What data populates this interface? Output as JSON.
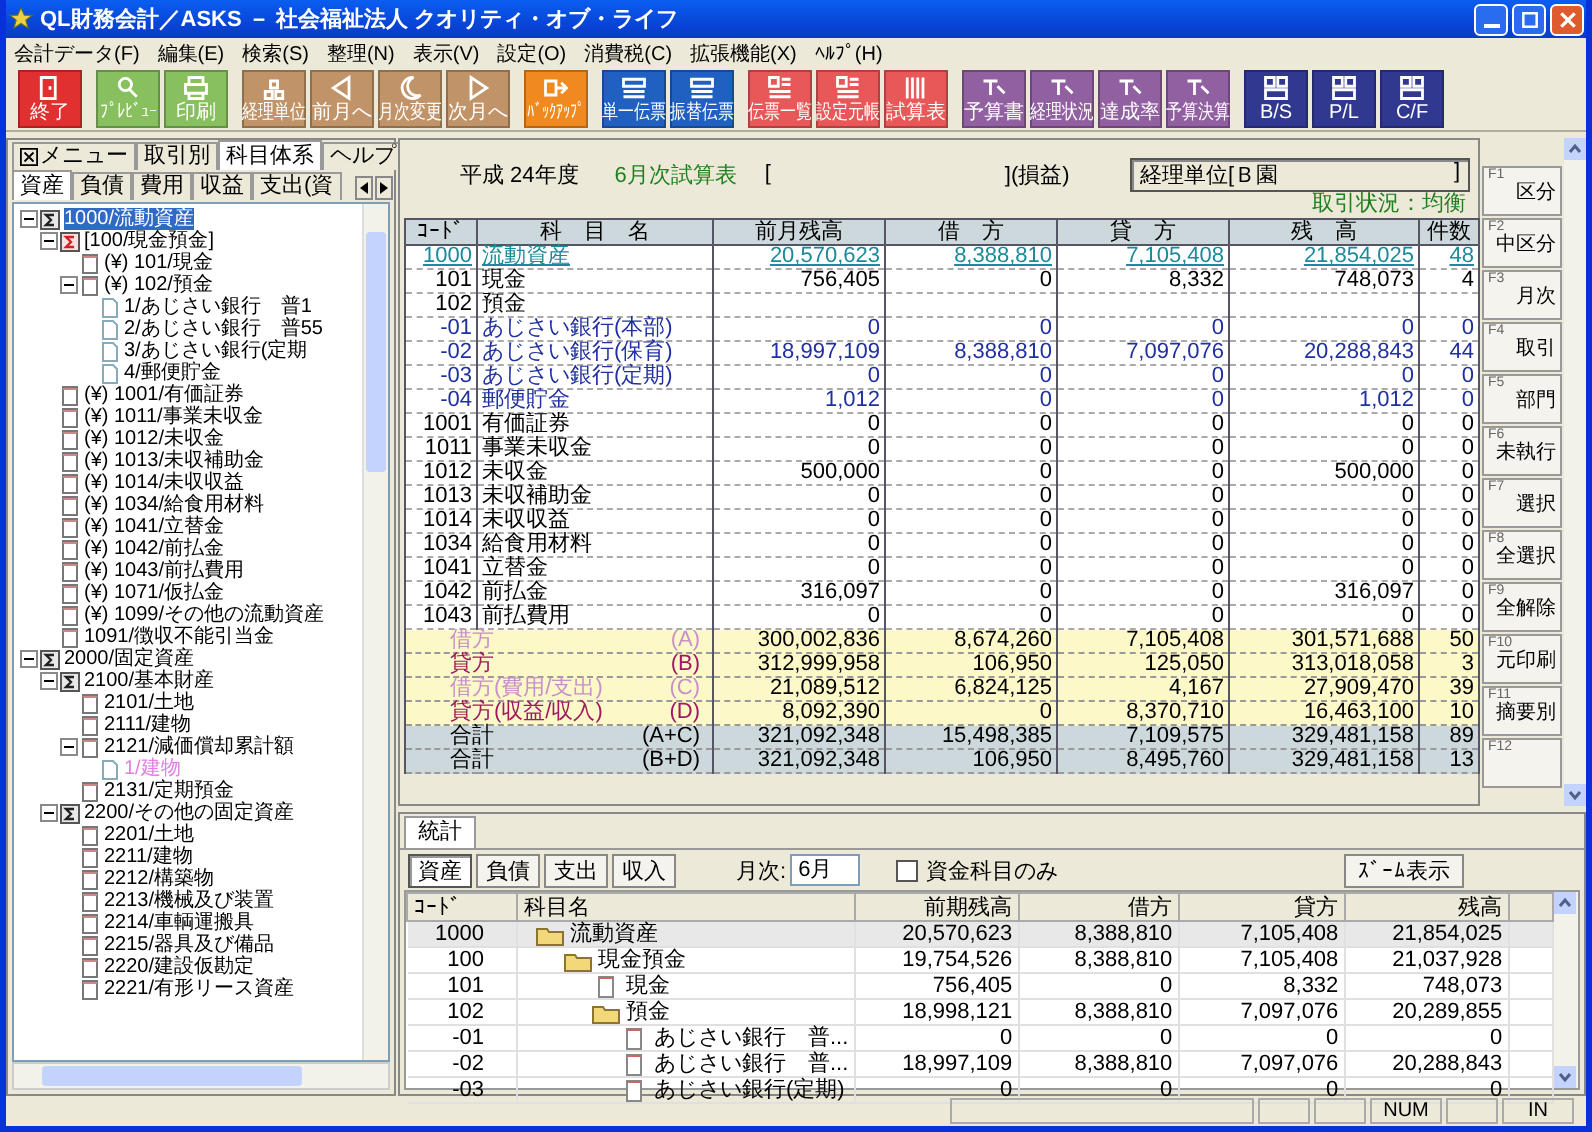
{
  "window": {
    "title": "QL財務会計／ASKS － 社会福祉法人 クオリティ・オブ・ライフ"
  },
  "menu": [
    "会計データ(F)",
    "編集(E)",
    "検索(S)",
    "整理(N)",
    "表示(V)",
    "設定(O)",
    "消費税(C)",
    "拡張機能(X)",
    "ﾍﾙﾌﾟ(H)"
  ],
  "toolbar": [
    {
      "label": "終了",
      "color": "#e03030"
    },
    {
      "label": "ﾌﾟﾚﾋﾞｭｰ",
      "color": "#88c060"
    },
    {
      "label": "印刷",
      "color": "#88c060"
    },
    {
      "label": "経理単位",
      "color": "#c09468"
    },
    {
      "label": "前月へ",
      "color": "#c09468"
    },
    {
      "label": "月次変更",
      "color": "#c09468"
    },
    {
      "label": "次月へ",
      "color": "#c09468"
    },
    {
      "label": "ﾊﾞｯｸｱｯﾌﾟ",
      "color": "#f08a20"
    },
    {
      "label": "単一伝票",
      "color": "#2060c0"
    },
    {
      "label": "振替伝票",
      "color": "#2060c0"
    },
    {
      "label": "伝票一覧",
      "color": "#e85858"
    },
    {
      "label": "設定元帳",
      "color": "#e85858"
    },
    {
      "label": "試算表",
      "color": "#e85858"
    },
    {
      "label": "予算書",
      "color": "#9060a0"
    },
    {
      "label": "経理状況",
      "color": "#9060a0"
    },
    {
      "label": "達成率",
      "color": "#9060a0"
    },
    {
      "label": "予算決算",
      "color": "#9060a0"
    },
    {
      "label": "B/S",
      "color": "#303890"
    },
    {
      "label": "P/L",
      "color": "#303890"
    },
    {
      "label": "C/F",
      "color": "#303890"
    }
  ],
  "left_panel": {
    "tabs": [
      {
        "label": "メニュー",
        "selected": false
      },
      {
        "label": "取引別",
        "selected": false
      },
      {
        "label": "科目体系",
        "selected": true
      },
      {
        "label": "ヘルプ",
        "selected": false
      }
    ],
    "subtabs": [
      {
        "label": "資産",
        "selected": true
      },
      {
        "label": "負債",
        "selected": false
      },
      {
        "label": "費用",
        "selected": false
      },
      {
        "label": "収益",
        "selected": false
      },
      {
        "label": "支出(資",
        "selected": false
      }
    ],
    "tree": [
      {
        "label": "1000/流動資産",
        "kind": "sum",
        "selected": true,
        "expanded": true,
        "children": [
          {
            "label": "[100/現金預金]",
            "kind": "sum-red",
            "selected": false,
            "expanded": true,
            "children": [
              {
                "label": "(¥) 101/現金",
                "kind": "account",
                "selected": false
              },
              {
                "label": "(¥) 102/預金",
                "kind": "account",
                "selected": false,
                "expanded": true,
                "children": [
                  {
                    "label": "1/あじさい銀行　普1",
                    "kind": "sub",
                    "selected": false
                  },
                  {
                    "label": "2/あじさい銀行　普55",
                    "kind": "sub",
                    "selected": false
                  },
                  {
                    "label": "3/あじさい銀行(定期",
                    "kind": "sub",
                    "selected": false
                  },
                  {
                    "label": "4/郵便貯金",
                    "kind": "sub",
                    "selected": false
                  }
                ]
              }
            ]
          },
          {
            "label": "(¥) 1001/有価証券",
            "kind": "account",
            "selected": false
          },
          {
            "label": "(¥) 1011/事業未収金",
            "kind": "account",
            "selected": false
          },
          {
            "label": "(¥) 1012/未収金",
            "kind": "account",
            "selected": false
          },
          {
            "label": "(¥) 1013/未収補助金",
            "kind": "account",
            "selected": false
          },
          {
            "label": "(¥) 1014/未収収益",
            "kind": "account",
            "selected": false
          },
          {
            "label": "(¥) 1034/給食用材料",
            "kind": "account",
            "selected": false
          },
          {
            "label": "(¥) 1041/立替金",
            "kind": "account",
            "selected": false
          },
          {
            "label": "(¥) 1042/前払金",
            "kind": "account",
            "selected": false
          },
          {
            "label": "(¥) 1043/前払費用",
            "kind": "account",
            "selected": false
          },
          {
            "label": "(¥) 1071/仮払金",
            "kind": "account",
            "selected": false
          },
          {
            "label": "(¥) 1099/その他の流動資産",
            "kind": "account",
            "selected": false
          },
          {
            "label": "1091/徴収不能引当金",
            "kind": "account",
            "selected": false
          }
        ]
      },
      {
        "label": "2000/固定資産",
        "kind": "sum",
        "selected": false,
        "expanded": true,
        "children": [
          {
            "label": "2100/基本財産",
            "kind": "sum",
            "selected": false,
            "expanded": true,
            "children": [
              {
                "label": "2101/土地",
                "kind": "account",
                "selected": false
              },
              {
                "label": "2111/建物",
                "kind": "account",
                "selected": false
              },
              {
                "label": "2121/減価償却累計額",
                "kind": "account",
                "selected": false,
                "expanded": true,
                "children": [
                  {
                    "label": "1/建物",
                    "kind": "sub-off",
                    "selected": false
                  }
                ]
              },
              {
                "label": "2131/定期預金",
                "kind": "account",
                "selected": false
              }
            ]
          },
          {
            "label": "2200/その他の固定資産",
            "kind": "sum",
            "selected": false,
            "expanded": true,
            "children": [
              {
                "label": "2201/土地",
                "kind": "account",
                "selected": false
              },
              {
                "label": "2211/建物",
                "kind": "account",
                "selected": false
              },
              {
                "label": "2212/構築物",
                "kind": "account",
                "selected": false
              },
              {
                "label": "2213/機械及び装置",
                "kind": "account",
                "selected": false
              },
              {
                "label": "2214/車輌運搬具",
                "kind": "account",
                "selected": false
              },
              {
                "label": "2215/器具及び備品",
                "kind": "account",
                "selected": false
              },
              {
                "label": "2220/建設仮勘定",
                "kind": "account",
                "selected": false
              },
              {
                "label": "2221/有形リース資産",
                "kind": "account",
                "selected": false
              }
            ]
          }
        ]
      }
    ]
  },
  "report": {
    "fiscal_year": "平成 24年度",
    "title": "6月次試算表",
    "bracket_open": "[",
    "bracket_close": "](損益)",
    "unit": "経理単位[Ｂ園",
    "unit_close": "]",
    "status": "取引状況：均衡",
    "columns": [
      "ｺｰﾄﾞ",
      "科　目　名",
      "前月残高",
      "借　方",
      "貸　方",
      "残　高",
      "件数"
    ],
    "rows": [
      {
        "kind": "group",
        "code": "1000",
        "name": "流動資産",
        "values": [
          "20,570,623",
          "8,388,810",
          "7,105,408",
          "21,854,025",
          "48"
        ]
      },
      {
        "kind": "account",
        "code": "101",
        "name": "現金",
        "values": [
          "756,405",
          "0",
          "8,332",
          "748,073",
          "4"
        ]
      },
      {
        "kind": "account",
        "code": "102",
        "name": "預金"
      },
      {
        "kind": "sub",
        "code": "-01",
        "name": "あじさい銀行(本部)",
        "values": [
          "0",
          "0",
          "0",
          "0",
          "0"
        ]
      },
      {
        "kind": "sub",
        "code": "-02",
        "name": "あじさい銀行(保育)",
        "values": [
          "18,997,109",
          "8,388,810",
          "7,097,076",
          "20,288,843",
          "44"
        ]
      },
      {
        "kind": "sub",
        "code": "-03",
        "name": "あじさい銀行(定期)",
        "values": [
          "0",
          "0",
          "0",
          "0",
          "0"
        ]
      },
      {
        "kind": "sub",
        "code": "-04",
        "name": "郵便貯金",
        "values": [
          "1,012",
          "0",
          "0",
          "1,012",
          "0"
        ]
      },
      {
        "kind": "account",
        "code": "1001",
        "name": "有価証券",
        "values": [
          "0",
          "0",
          "0",
          "0",
          "0"
        ]
      },
      {
        "kind": "account",
        "code": "1011",
        "name": "事業未収金",
        "values": [
          "0",
          "0",
          "0",
          "0",
          "0"
        ]
      },
      {
        "kind": "account",
        "code": "1012",
        "name": "未収金",
        "values": [
          "500,000",
          "0",
          "0",
          "500,000",
          "0"
        ]
      },
      {
        "kind": "account",
        "code": "1013",
        "name": "未収補助金",
        "values": [
          "0",
          "0",
          "0",
          "0",
          "0"
        ]
      },
      {
        "kind": "account",
        "code": "1014",
        "name": "未収収益",
        "values": [
          "0",
          "0",
          "0",
          "0",
          "0"
        ]
      },
      {
        "kind": "account",
        "code": "1034",
        "name": "給食用材料",
        "values": [
          "0",
          "0",
          "0",
          "0",
          "0"
        ]
      },
      {
        "kind": "account",
        "code": "1041",
        "name": "立替金",
        "values": [
          "0",
          "0",
          "0",
          "0",
          "0"
        ]
      },
      {
        "kind": "account",
        "code": "1042",
        "name": "前払金",
        "values": [
          "316,097",
          "0",
          "0",
          "316,097",
          "0"
        ]
      },
      {
        "kind": "account",
        "code": "1043",
        "name": "前払費用",
        "values": [
          "0",
          "0",
          "0",
          "0",
          "0"
        ]
      },
      {
        "kind": "total",
        "name": "借方",
        "tag": "(A)",
        "color": "#c890c8",
        "values": [
          "300,002,836",
          "8,674,260",
          "7,105,408",
          "301,571,688",
          "50"
        ]
      },
      {
        "kind": "total",
        "name": "貸方",
        "tag": "(B)",
        "color": "#a01860",
        "values": [
          "312,999,958",
          "106,950",
          "125,050",
          "313,018,058",
          "3"
        ]
      },
      {
        "kind": "total",
        "name": "借方(費用/支出)",
        "tag": "(C)",
        "color": "#c890c8",
        "values": [
          "21,089,512",
          "6,824,125",
          "4,167",
          "27,909,470",
          "39"
        ]
      },
      {
        "kind": "total",
        "name": "貸方(収益/収入)",
        "tag": "(D)",
        "color": "#a01860",
        "values": [
          "8,092,390",
          "0",
          "8,370,710",
          "16,463,100",
          "10"
        ]
      },
      {
        "kind": "sum",
        "name": "合計",
        "tag": "(A+C)",
        "values": [
          "321,092,348",
          "15,498,385",
          "7,109,575",
          "329,481,158",
          "89"
        ]
      },
      {
        "kind": "sum",
        "name": "合計",
        "tag": "(B+D)",
        "values": [
          "321,092,348",
          "106,950",
          "8,495,760",
          "329,481,158",
          "13"
        ]
      }
    ]
  },
  "function_keys": [
    {
      "key": "F1",
      "label": "区分"
    },
    {
      "key": "F2",
      "label": "中区分"
    },
    {
      "key": "F3",
      "label": "月次"
    },
    {
      "key": "F4",
      "label": "取引"
    },
    {
      "key": "F5",
      "label": "部門"
    },
    {
      "key": "F6",
      "label": "未執行"
    },
    {
      "key": "F7",
      "label": "選択"
    },
    {
      "key": "F8",
      "label": "全選択"
    },
    {
      "key": "F9",
      "label": "全解除"
    },
    {
      "key": "F10",
      "label": "元印刷"
    },
    {
      "key": "F11",
      "label": "摘要別"
    },
    {
      "key": "F12"
    }
  ],
  "bottom_panel": {
    "tab": "統計",
    "buttons": [
      {
        "label": "資産",
        "selected": true
      },
      {
        "label": "負債",
        "selected": false
      },
      {
        "label": "支出",
        "selected": false
      },
      {
        "label": "収入",
        "selected": false
      }
    ],
    "month_label": "月次:",
    "month_value": "6月",
    "fund_only": {
      "label": "資金科目のみ",
      "checked": false
    },
    "zoom_button": "ｽﾞｰﾑ表示",
    "grid": {
      "columns": [
        "ｺｰﾄﾞ",
        "科目名",
        "前期残高",
        "借方",
        "貸方",
        "残高"
      ],
      "rows": [
        {
          "code": "1000",
          "name": "流動資産",
          "kind": "folder",
          "selected": true,
          "values": [
            "20,570,623",
            "8,388,810",
            "7,105,408",
            "21,854,025"
          ],
          "children": [
            {
              "code": "100",
              "name": "現金預金",
              "kind": "folder",
              "selected": false,
              "values": [
                "19,754,526",
                "8,388,810",
                "7,105,408",
                "21,037,928"
              ],
              "children": [
                {
                  "code": "101",
                  "name": "現金",
                  "kind": "doc",
                  "selected": false,
                  "values": [
                    "756,405",
                    "0",
                    "8,332",
                    "748,073"
                  ]
                },
                {
                  "code": "102",
                  "name": "預金",
                  "kind": "folder",
                  "selected": false,
                  "values": [
                    "18,998,121",
                    "8,388,810",
                    "7,097,076",
                    "20,289,855"
                  ],
                  "children": [
                    {
                      "code": "-01",
                      "name": "あじさい銀行　普...",
                      "kind": "doc",
                      "selected": false,
                      "values": [
                        "0",
                        "0",
                        "0",
                        "0"
                      ]
                    },
                    {
                      "code": "-02",
                      "name": "あじさい銀行　普...",
                      "kind": "doc",
                      "selected": false,
                      "values": [
                        "18,997,109",
                        "8,388,810",
                        "7,097,076",
                        "20,288,843"
                      ]
                    },
                    {
                      "code": "-03",
                      "name": "あじさい銀行(定期)",
                      "kind": "doc",
                      "selected": false,
                      "values": [
                        "0",
                        "0",
                        "0",
                        "0"
                      ]
                    }
                  ]
                }
              ]
            }
          ]
        }
      ]
    }
  },
  "status_bar": [
    "NUM",
    "IN"
  ]
}
